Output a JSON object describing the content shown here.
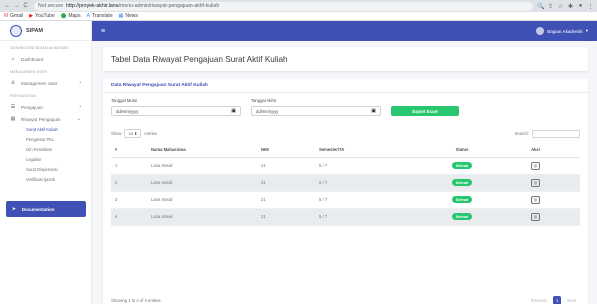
{
  "browser": {
    "back": "←",
    "forward": "→",
    "reload": "C",
    "security": "Not secure",
    "url_host": "http://proyek-akhir.lana",
    "url_path": "/menu-admin/riwayat-pengajuan-aktif-kuliah",
    "bookmarks": [
      "Gmail",
      "YouTube",
      "Maps",
      "Translate",
      "News"
    ]
  },
  "sidebar": {
    "brand": "SIPAM",
    "sections": {
      "dashboard": "DASHBOARD BIDAN AKADEMIK",
      "user": "MANAGEMEN USER",
      "surat": "PERSURATAN"
    },
    "items": {
      "dashboard": "Dashboard",
      "users": "Managemen User",
      "pengajuan": "Pengajuan",
      "riwayat": "Riwayat Pengajuan"
    },
    "subitems": [
      "Surat Aktif Kuliah",
      "Pengantar PKL",
      "Izin Penelitian",
      "Legalisir",
      "Surat Dispensasi",
      "Verifikasi Ijazah"
    ],
    "doc_button": "Documentation"
  },
  "topbar": {
    "user": "Bagian Akademik"
  },
  "page": {
    "title": "Tabel Data Riwayat Pengajuan Surat Aktif Kuliah",
    "card_title": "Data Riwayat Pengajuan Surat Aktif Kuliah",
    "filters": {
      "start_label": "Tanggal Mulai",
      "end_label": "Tanggal Akhir",
      "start_value": "dd/mm/yyyy",
      "end_value": "dd/mm/yyyy",
      "export": "Export Excel"
    },
    "length": {
      "show": "Show",
      "value": "10",
      "entries": "entries"
    },
    "search_label": "Search:",
    "columns": [
      "#",
      "Nama Mahasiswa",
      "NIM",
      "Semester/TA",
      "Status",
      "Aksi"
    ],
    "rows": [
      {
        "no": "1",
        "nama": "Lana Ismail",
        "nim": "21",
        "sem": "5 / 7",
        "status": "Selesai"
      },
      {
        "no": "2",
        "nama": "Lana Ismail",
        "nim": "21",
        "sem": "5 / 7",
        "status": "Selesai"
      },
      {
        "no": "3",
        "nama": "Lana Ismail",
        "nim": "21",
        "sem": "5 / 7",
        "status": "Selesai"
      },
      {
        "no": "4",
        "nama": "Lana Ismail",
        "nim": "21",
        "sem": "5 / 7",
        "status": "Selesai"
      }
    ],
    "info": "Showing 1 to 4 of 4 entries",
    "pager": {
      "prev": "Previous",
      "current": "1",
      "next": "Next"
    }
  }
}
